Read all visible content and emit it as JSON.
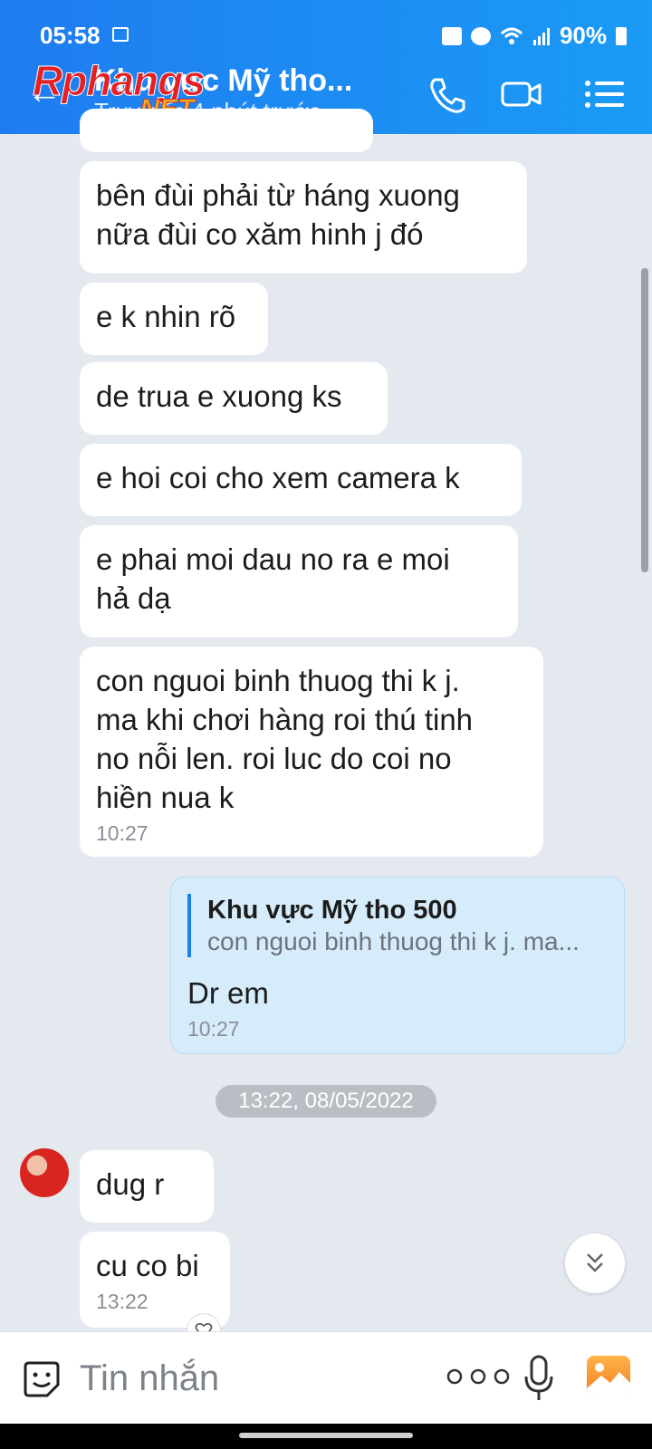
{
  "status_bar": {
    "time": "05:58",
    "battery": "90%"
  },
  "header": {
    "title": "Khu vực Mỹ tho...",
    "subtitle": "Truy cập 4 phút trước",
    "watermark_main": "Rphangs",
    "watermark_sub": ".NET"
  },
  "messages": [
    {
      "sender": "them",
      "text": "bên đùi phải từ háng xuong\nnữa đùi co xăm hinh j đó"
    },
    {
      "sender": "them",
      "text": "e k nhin rõ"
    },
    {
      "sender": "them",
      "text": "de trua e xuong ks"
    },
    {
      "sender": "them",
      "text": "e hoi coi cho xem camera k"
    },
    {
      "sender": "them",
      "text": "e phai moi dau no ra e moi\nhả dạ"
    },
    {
      "sender": "them",
      "text": "con nguoi binh thuog thi k j.\nma khi chơi hàng roi thú tinh\nno nỗi len. roi luc do coi no\nhiền nua k",
      "time": "10:27"
    },
    {
      "sender": "me",
      "quote_name": "Khu vực Mỹ tho 500",
      "quote_text": "con nguoi binh thuog thi k j. ma...",
      "text": "Dr em",
      "time": "10:27"
    },
    {
      "sender": "them",
      "text": "dug r"
    },
    {
      "sender": "them",
      "text": "cu co bi",
      "time": "13:22"
    }
  ],
  "date_separator": "13:22, 08/05/2022",
  "input": {
    "placeholder": "Tin nhắn"
  },
  "icons": {
    "back": "back-arrow-icon",
    "call": "phone-icon",
    "video": "video-camera-icon",
    "menu": "list-menu-icon",
    "sticker": "sticker-smile-icon",
    "more": "more-dots-icon",
    "mic": "microphone-icon",
    "gallery": "gallery-image-icon",
    "scroll_down": "double-chevron-down-icon",
    "reaction": "heart-icon"
  },
  "colors": {
    "header": "#1f7cf0",
    "my_bubble": "#d6ecfb",
    "their_bubble": "#ffffff",
    "background": "#e4e9f0"
  }
}
